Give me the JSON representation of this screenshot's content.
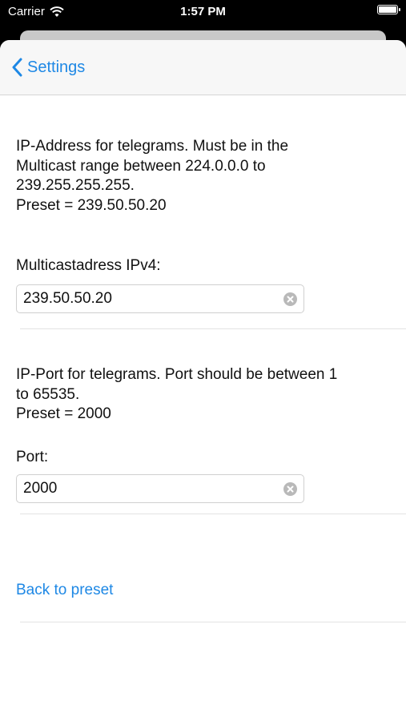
{
  "status_bar": {
    "carrier": "Carrier",
    "time": "1:57 PM"
  },
  "nav": {
    "back_label": "Settings"
  },
  "multicast": {
    "description_lines": [
      "IP-Address for telegrams. Must be in the",
      "Multicast range between 224.0.0.0 to",
      "239.255.255.255.",
      "Preset = 239.50.50.20"
    ],
    "label": "Multicastadress IPv4:",
    "value": "239.50.50.20"
  },
  "port": {
    "description_lines": [
      "IP-Port for telegrams. Port should be between 1",
      "to 65535.",
      "Preset = 2000"
    ],
    "label": "Port:",
    "value": "2000"
  },
  "reset": {
    "label": "Back to preset"
  },
  "colors": {
    "accent": "#1e88e5",
    "status_bar_bg": "#000000",
    "navbar_bg": "#f7f7f7"
  },
  "icons": {
    "wifi": "wifi-icon",
    "battery": "battery-icon",
    "back": "chevron-left-icon",
    "clear": "clear-circle-x-icon"
  }
}
